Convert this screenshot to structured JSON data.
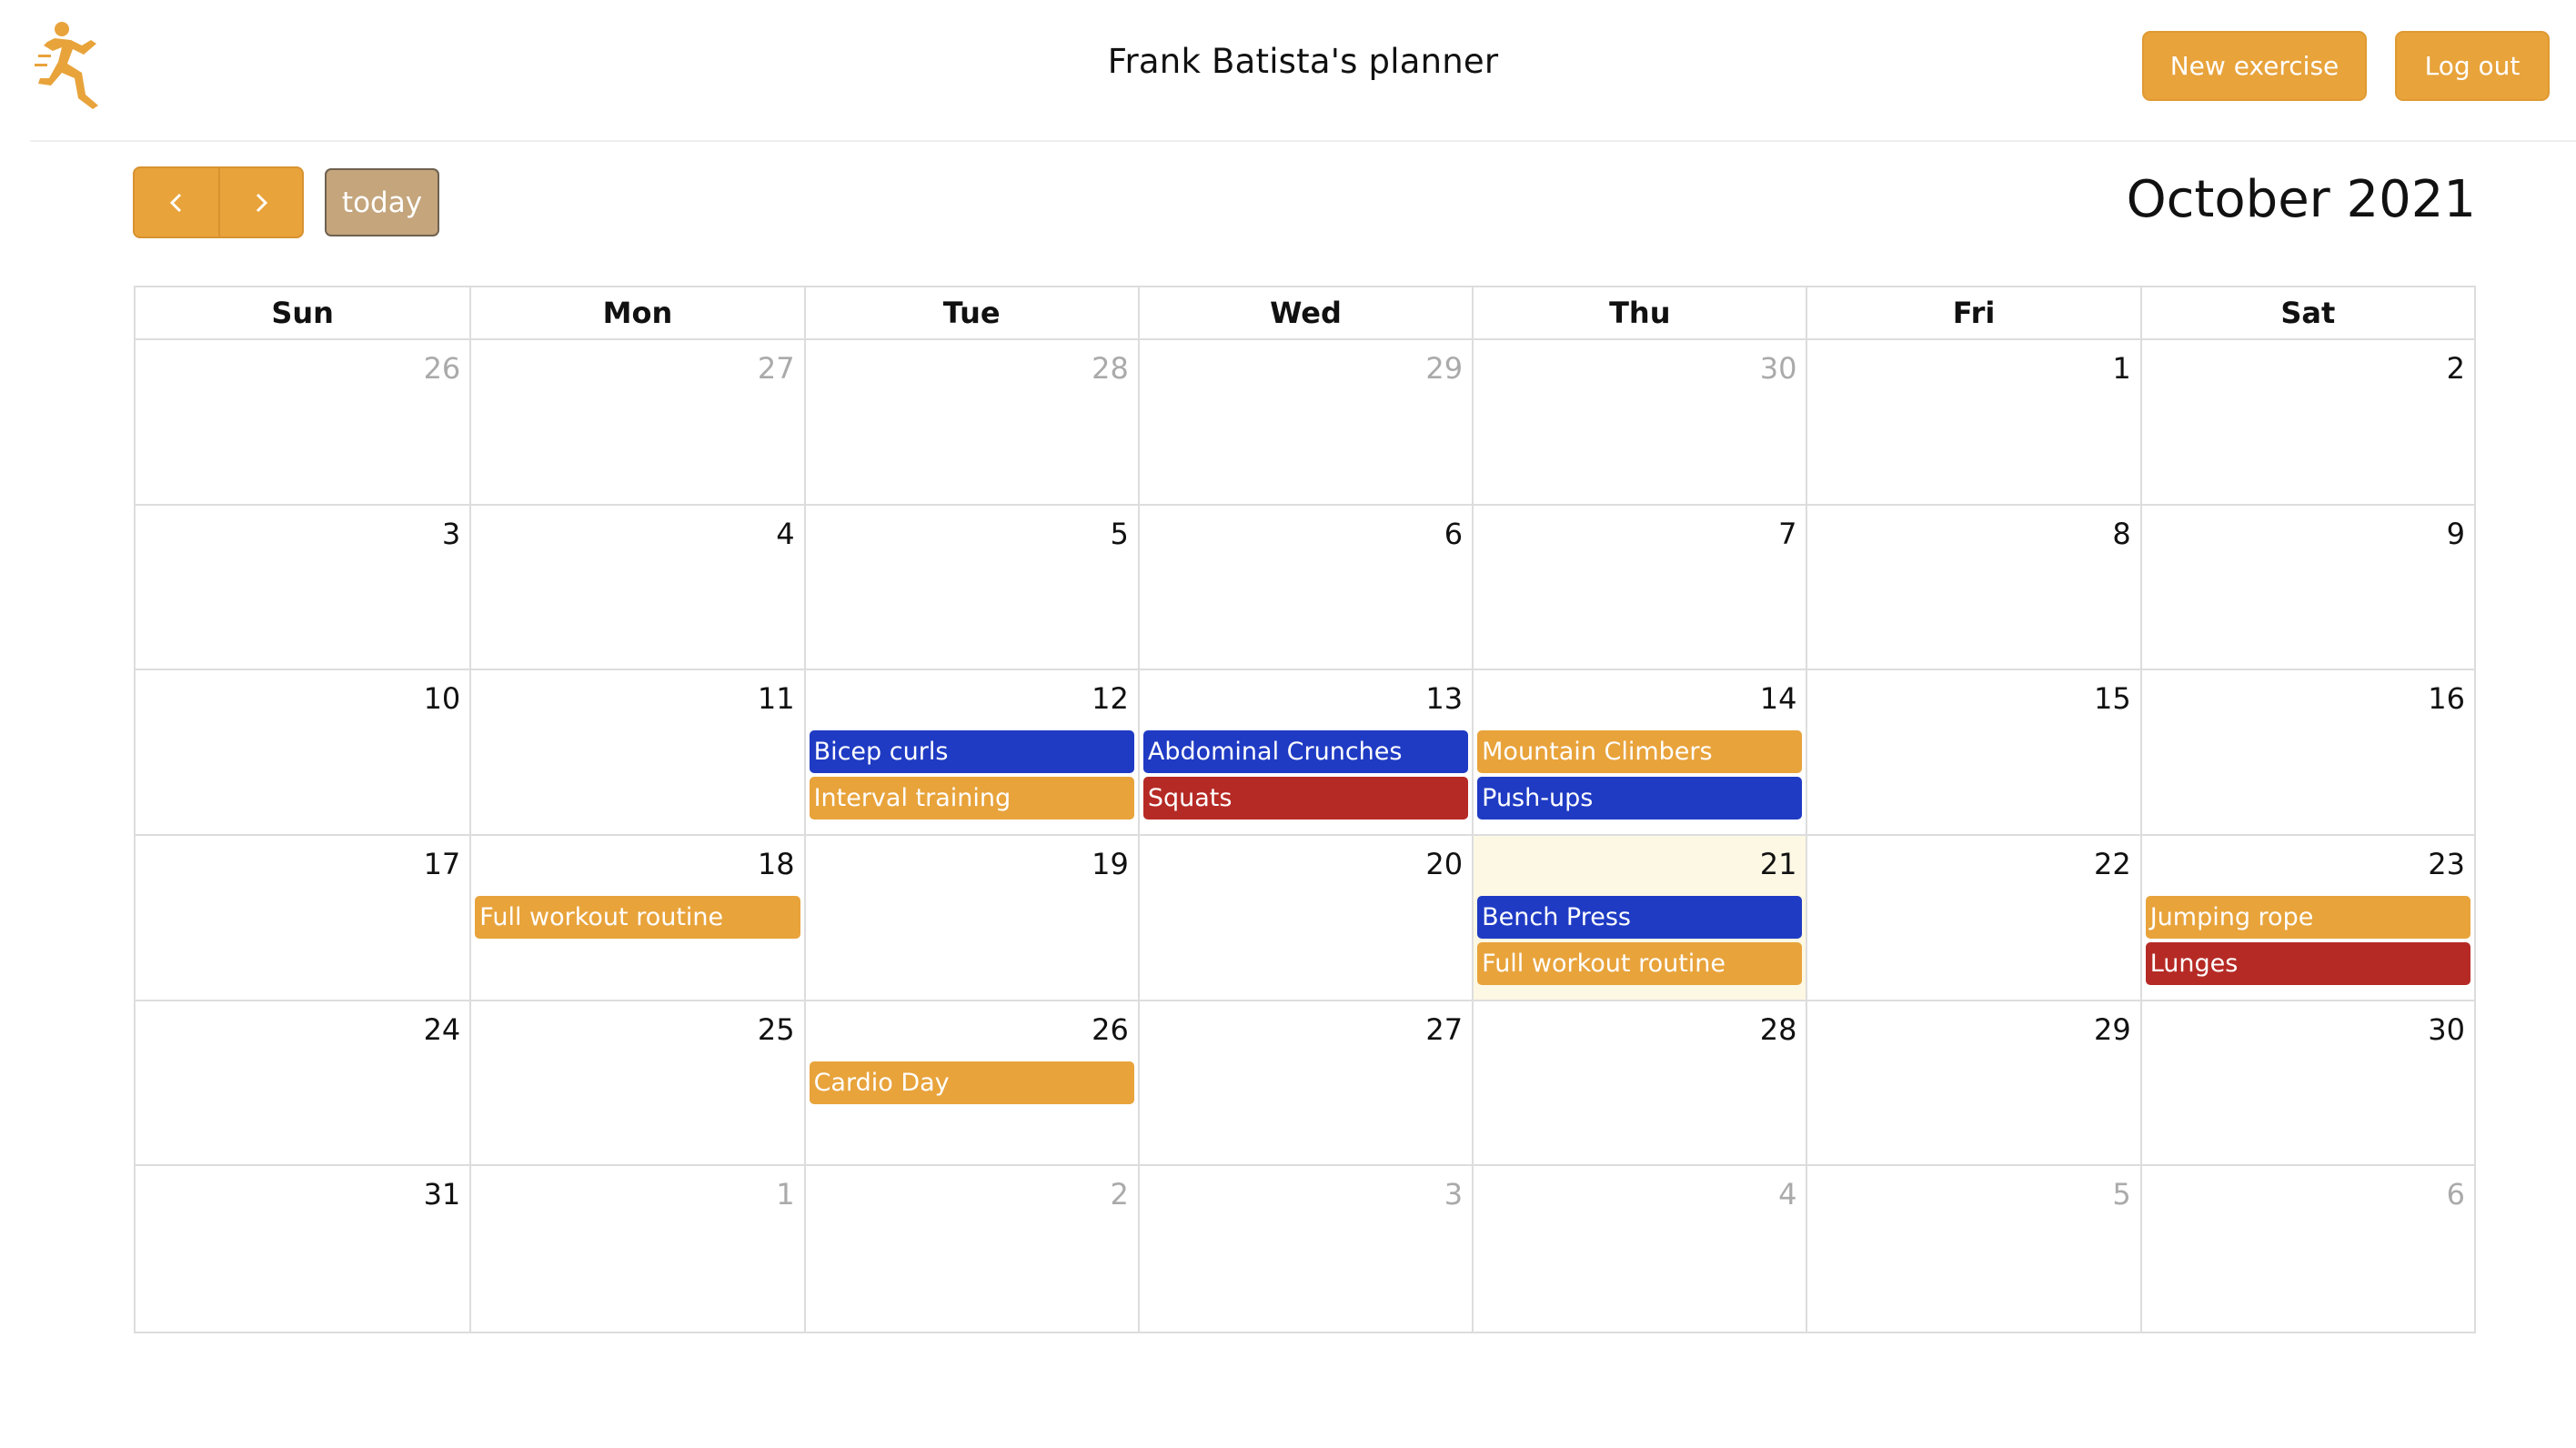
{
  "header": {
    "title": "Frank Batista's planner",
    "new_exercise_label": "New exercise",
    "logout_label": "Log out"
  },
  "toolbar": {
    "today_label": "today",
    "month_title": "October 2021"
  },
  "calendar": {
    "weekdays": [
      "Sun",
      "Mon",
      "Tue",
      "Wed",
      "Thu",
      "Fri",
      "Sat"
    ],
    "weeks": [
      {
        "days": [
          {
            "num": "26",
            "other": true,
            "events": []
          },
          {
            "num": "27",
            "other": true,
            "events": []
          },
          {
            "num": "28",
            "other": true,
            "events": []
          },
          {
            "num": "29",
            "other": true,
            "events": []
          },
          {
            "num": "30",
            "other": true,
            "events": []
          },
          {
            "num": "1",
            "events": []
          },
          {
            "num": "2",
            "events": []
          }
        ]
      },
      {
        "days": [
          {
            "num": "3",
            "events": []
          },
          {
            "num": "4",
            "events": []
          },
          {
            "num": "5",
            "events": []
          },
          {
            "num": "6",
            "events": []
          },
          {
            "num": "7",
            "events": []
          },
          {
            "num": "8",
            "events": []
          },
          {
            "num": "9",
            "events": []
          }
        ]
      },
      {
        "days": [
          {
            "num": "10",
            "events": []
          },
          {
            "num": "11",
            "events": []
          },
          {
            "num": "12",
            "events": [
              {
                "title": "Bicep curls",
                "color": "#1f3bc4"
              },
              {
                "title": "Interval training",
                "color": "#e8a33b"
              }
            ]
          },
          {
            "num": "13",
            "events": [
              {
                "title": "Abdominal Crunches",
                "color": "#1f3bc4"
              },
              {
                "title": "Squats",
                "color": "#b62a25"
              }
            ]
          },
          {
            "num": "14",
            "events": [
              {
                "title": "Mountain Climbers",
                "color": "#e8a33b"
              },
              {
                "title": "Push-ups",
                "color": "#1f3bc4"
              }
            ]
          },
          {
            "num": "15",
            "events": []
          },
          {
            "num": "16",
            "events": []
          }
        ]
      },
      {
        "days": [
          {
            "num": "17",
            "events": []
          },
          {
            "num": "18",
            "events": [
              {
                "title": "Full workout routine",
                "color": "#e8a33b"
              }
            ]
          },
          {
            "num": "19",
            "events": []
          },
          {
            "num": "20",
            "events": []
          },
          {
            "num": "21",
            "today": true,
            "events": [
              {
                "title": "Bench Press",
                "color": "#1f3bc4"
              },
              {
                "title": "Full workout routine",
                "color": "#e8a33b"
              }
            ]
          },
          {
            "num": "22",
            "events": []
          },
          {
            "num": "23",
            "events": [
              {
                "title": "Jumping rope",
                "color": "#e8a33b"
              },
              {
                "title": "Lunges",
                "color": "#b62a25"
              }
            ]
          }
        ]
      },
      {
        "days": [
          {
            "num": "24",
            "events": []
          },
          {
            "num": "25",
            "events": []
          },
          {
            "num": "26",
            "events": [
              {
                "title": "Cardio Day",
                "color": "#e8a33b"
              }
            ]
          },
          {
            "num": "27",
            "events": []
          },
          {
            "num": "28",
            "events": []
          },
          {
            "num": "29",
            "events": []
          },
          {
            "num": "30",
            "events": []
          }
        ]
      },
      {
        "days": [
          {
            "num": "31",
            "events": []
          },
          {
            "num": "1",
            "other": true,
            "events": []
          },
          {
            "num": "2",
            "other": true,
            "events": []
          },
          {
            "num": "3",
            "other": true,
            "events": []
          },
          {
            "num": "4",
            "other": true,
            "events": []
          },
          {
            "num": "5",
            "other": true,
            "events": []
          },
          {
            "num": "6",
            "other": true,
            "events": []
          }
        ]
      }
    ]
  },
  "colors": {
    "accent": "#e8a33b",
    "today_button": "#c4a57c",
    "event_blue": "#1f3bc4",
    "event_red": "#b62a25",
    "today_highlight": "#fdf8e4"
  },
  "icons": {
    "logo": "running-man-icon",
    "prev": "chevron-left-icon",
    "next": "chevron-right-icon"
  }
}
